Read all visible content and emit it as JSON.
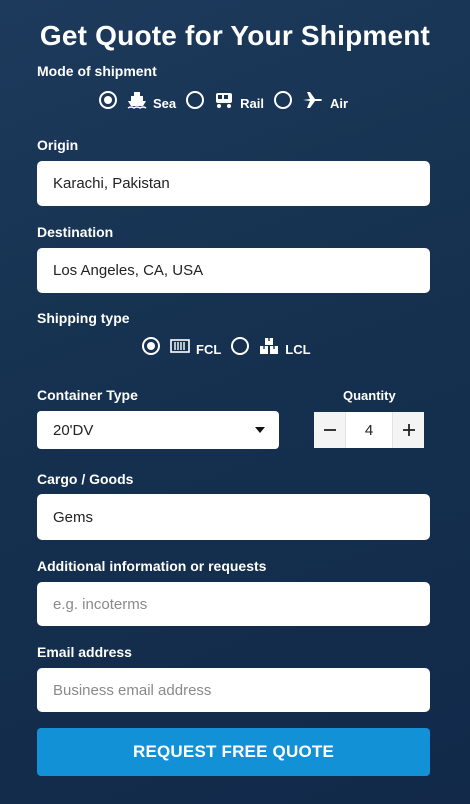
{
  "form": {
    "title": "Get Quote for Your Shipment",
    "mode_label": "Mode of shipment",
    "modes": [
      {
        "label": "Sea",
        "icon": "ship-icon",
        "selected": true
      },
      {
        "label": "Rail",
        "icon": "train-icon",
        "selected": false
      },
      {
        "label": "Air",
        "icon": "airplane-icon",
        "selected": false
      }
    ],
    "origin": {
      "label": "Origin",
      "value": "Karachi, Pakistan"
    },
    "destination": {
      "label": "Destination",
      "value": "Los Angeles, CA, USA"
    },
    "shipping_type_label": "Shipping type",
    "shipping_types": [
      {
        "label": "FCL",
        "icon": "container-icon",
        "selected": true
      },
      {
        "label": "LCL",
        "icon": "boxes-icon",
        "selected": false
      }
    ],
    "container_type": {
      "label": "Container Type",
      "value": "20'DV"
    },
    "quantity": {
      "label": "Quantity",
      "value": "4",
      "minus": "−",
      "plus": "+"
    },
    "cargo": {
      "label": "Cargo / Goods",
      "value": "Gems"
    },
    "additional": {
      "label": "Additional information or requests",
      "placeholder": "e.g. incoterms"
    },
    "email": {
      "label": "Email address",
      "placeholder": "Business email address"
    },
    "submit_label": "REQUEST FREE QUOTE"
  },
  "colors": {
    "background": "#163352",
    "button": "#1391d6",
    "field": "#ffffff"
  }
}
